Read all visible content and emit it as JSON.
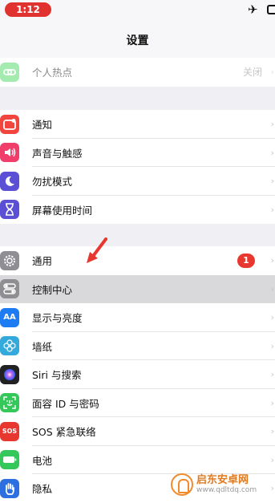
{
  "status": {
    "time": "1:12",
    "airplane": "✈"
  },
  "nav": {
    "title": "设置"
  },
  "groups": {
    "top": [
      {
        "label": "个人热点",
        "value": "关闭",
        "icon": "hotspot-icon",
        "color": "#4cd964"
      }
    ],
    "g2": [
      {
        "label": "通知",
        "icon": "notifications-icon",
        "color": "#f2453d"
      },
      {
        "label": "声音与触感",
        "icon": "sounds-icon",
        "color": "#f03d6a"
      },
      {
        "label": "勿扰模式",
        "icon": "moon-icon",
        "color": "#5b4fd6"
      },
      {
        "label": "屏幕使用时间",
        "icon": "hourglass-icon",
        "color": "#5b4fd6"
      }
    ],
    "g3": [
      {
        "label": "通用",
        "icon": "gear-icon",
        "color": "#8e8e93",
        "badge": "1"
      },
      {
        "label": "控制中心",
        "icon": "toggles-icon",
        "color": "#8e8e93"
      },
      {
        "label": "显示与亮度",
        "icon": "display-icon",
        "color": "#1e7cf2",
        "glyph": "AA"
      },
      {
        "label": "墙纸",
        "icon": "wallpaper-icon",
        "color": "#34aadc"
      },
      {
        "label": "Siri 与搜索",
        "icon": "siri-icon",
        "color": "#222"
      },
      {
        "label": "面容 ID 与密码",
        "icon": "faceid-icon",
        "color": "#34c759"
      },
      {
        "label": "SOS 紧急联络",
        "icon": "sos-icon",
        "color": "#e8372e",
        "glyph": "SOS"
      },
      {
        "label": "电池",
        "icon": "battery-icon",
        "color": "#34c759"
      },
      {
        "label": "隐私",
        "icon": "hand-icon",
        "color": "#2d6fe0"
      }
    ]
  },
  "chevron": "›",
  "watermark": {
    "title": "启东安卓网",
    "url": "www.qdltdq.com"
  }
}
